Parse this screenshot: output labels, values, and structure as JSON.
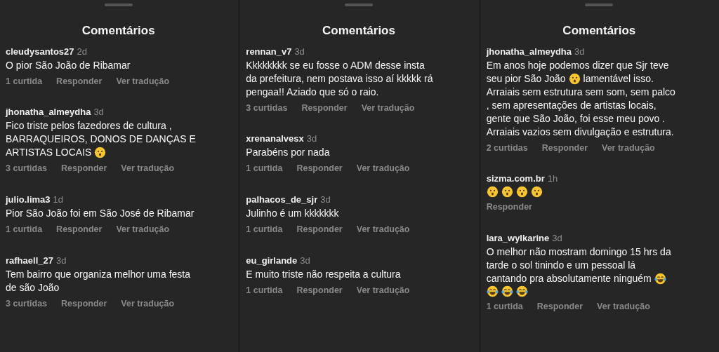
{
  "panels": [
    {
      "title": "Comentários",
      "comments": [
        {
          "username": "cleudysantos27",
          "time": "2d",
          "lines": [
            [
              {
                "kind": "text",
                "text": "O pior São João de Ribamar"
              }
            ]
          ],
          "likes": "1 curtida",
          "reply": "Responder",
          "translate": "Ver tradução"
        },
        {
          "username": "jhonatha_almeydha",
          "time": "3d",
          "lines": [
            [
              {
                "kind": "text",
                "text": "Fico triste pelos fazedores de cultura ,"
              }
            ],
            [
              {
                "kind": "text",
                "text": "BARRAQUEIROS, DONOS DE DANÇAS E"
              }
            ],
            [
              {
                "kind": "text",
                "text": "ARTISTAS LOCAIS"
              },
              {
                "kind": "surprised"
              }
            ]
          ],
          "likes": "3 curtidas",
          "reply": "Responder",
          "translate": "Ver tradução"
        },
        {
          "username": "julio.lima3",
          "time": "1d",
          "lines": [
            [
              {
                "kind": "text",
                "text": "Pior São João foi em São José de Ribamar"
              }
            ]
          ],
          "likes": "1 curtida",
          "reply": "Responder",
          "translate": "Ver tradução"
        },
        {
          "username": "rafhaell_27",
          "time": "3d",
          "lines": [
            [
              {
                "kind": "text",
                "text": "Tem bairro que organiza melhor uma festa"
              }
            ],
            [
              {
                "kind": "text",
                "text": "de são João"
              }
            ]
          ],
          "likes": "3 curtidas",
          "reply": "Responder",
          "translate": "Ver tradução"
        }
      ]
    },
    {
      "title": "Comentários",
      "comments": [
        {
          "username": "rennan_v7",
          "time": "3d",
          "lines": [
            [
              {
                "kind": "text",
                "text": "Kkkkkkkk se eu fosse o ADM desse insta"
              }
            ],
            [
              {
                "kind": "text",
                "text": "da prefeitura, nem postava isso aí kkkkk rá"
              }
            ],
            [
              {
                "kind": "text",
                "text": "pengaa!! Aziado que só o raio."
              }
            ]
          ],
          "likes": "3 curtidas",
          "reply": "Responder",
          "translate": "Ver tradução"
        },
        {
          "username": "xrenanalvesx",
          "time": "3d",
          "lines": [
            [
              {
                "kind": "text",
                "text": "Parabéns por nada"
              }
            ]
          ],
          "likes": "1 curtida",
          "reply": "Responder",
          "translate": "Ver tradução"
        },
        {
          "username": "palhacos_de_sjr",
          "time": "3d",
          "lines": [
            [
              {
                "kind": "text",
                "text": "Julinho é um  kkkkkkk"
              }
            ]
          ],
          "likes": "1 curtida",
          "reply": "Responder",
          "translate": "Ver tradução"
        },
        {
          "username": "eu_girlande",
          "time": "3d",
          "lines": [
            [
              {
                "kind": "text",
                "text": "E muito triste não respeita a cultura"
              }
            ]
          ],
          "likes": "1 curtida",
          "reply": "Responder",
          "translate": "Ver tradução"
        }
      ]
    },
    {
      "title": "Comentários",
      "comments": [
        {
          "username": "jhonatha_almeydha",
          "time": "3d",
          "lines": [
            [
              {
                "kind": "text",
                "text": "Em anos hoje podemos dizer que Sjr teve"
              }
            ],
            [
              {
                "kind": "text",
                "text": "seu pior São João"
              },
              {
                "kind": "surprised"
              },
              {
                "kind": "text",
                "text": "lamentável isso."
              }
            ],
            [
              {
                "kind": "text",
                "text": "Arraiais sem estrutura sem som, sem palco"
              }
            ],
            [
              {
                "kind": "text",
                "text": ", sem apresentações de artistas  locais,"
              }
            ],
            [
              {
                "kind": "text",
                "text": "gente que São João, foi esse meu povo ."
              }
            ],
            [
              {
                "kind": "text",
                "text": "Arraiais vazios sem divulgação e estrutura."
              }
            ]
          ],
          "likes": "2 curtidas",
          "reply": "Responder",
          "translate": "Ver tradução"
        },
        {
          "username": "sizma.com.br",
          "time": "1h",
          "lines": [
            [
              {
                "kind": "surprised"
              },
              {
                "kind": "surprised"
              },
              {
                "kind": "surprised"
              },
              {
                "kind": "surprised"
              }
            ]
          ],
          "reply": "Responder"
        },
        {
          "username": "lara_wylkarine",
          "time": "3d",
          "lines": [
            [
              {
                "kind": "text",
                "text": "O melhor não mostram domingo 15 hrs da"
              }
            ],
            [
              {
                "kind": "text",
                "text": "tarde o sol tinindo e um pessoal lá"
              }
            ],
            [
              {
                "kind": "text",
                "text": "cantando pra absolutamente ninguém"
              },
              {
                "kind": "laughing"
              }
            ],
            [
              {
                "kind": "laughing"
              },
              {
                "kind": "laughing"
              },
              {
                "kind": "laughing"
              }
            ]
          ],
          "likes": "1 curtida",
          "reply": "Responder",
          "translate": "Ver tradução"
        }
      ]
    }
  ]
}
